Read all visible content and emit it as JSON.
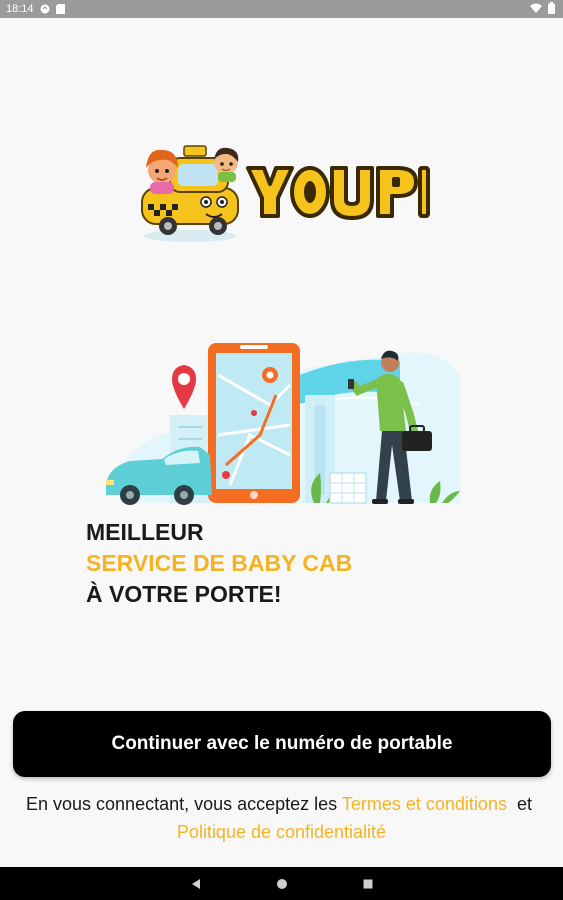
{
  "status_bar": {
    "time": "18:14",
    "icons": [
      "sync-icon",
      "sd-card-icon",
      "wifi-icon",
      "battery-icon"
    ]
  },
  "logo": {
    "text": "YOUPI"
  },
  "headline": {
    "line1": "MEILLEUR",
    "line2": "SERVICE DE BABY CAB",
    "line3": "À VOTRE PORTE!"
  },
  "cta": {
    "label": "Continuer avec le numéro de portable"
  },
  "terms": {
    "prefix": "En vous connectant, vous acceptez les",
    "terms_link": "Termes et conditions",
    "conjunction": "et",
    "privacy_link": "Politique de confidentialité"
  },
  "nav_bar": {
    "icons": [
      "back-icon",
      "home-icon",
      "recents-icon"
    ]
  },
  "colors": {
    "accent": "#f5b323",
    "button": "#000000",
    "background": "#f8f8f8"
  }
}
